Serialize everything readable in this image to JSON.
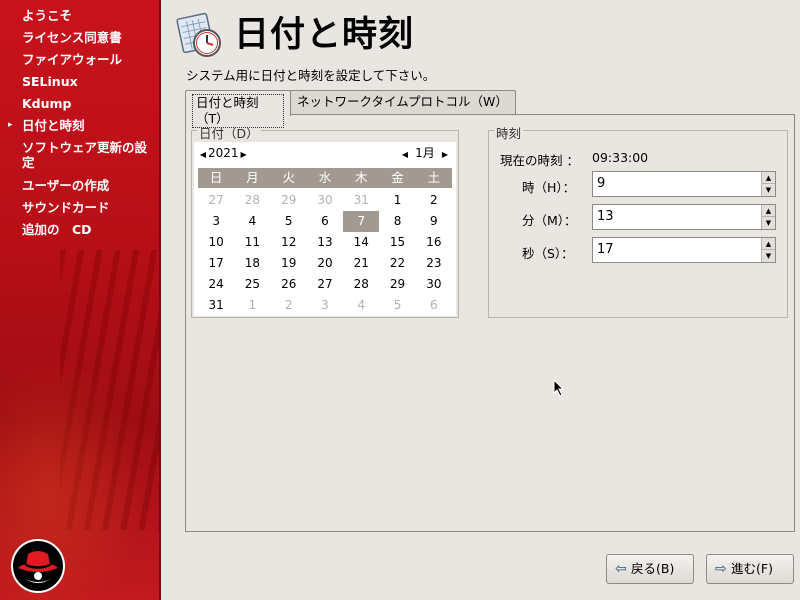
{
  "sidebar": {
    "items": [
      {
        "label": "ようこそ",
        "current": false
      },
      {
        "label": "ライセンス同意書",
        "current": false
      },
      {
        "label": "ファイアウォール",
        "current": false
      },
      {
        "label": "SELinux",
        "current": false
      },
      {
        "label": "Kdump",
        "current": false
      },
      {
        "label": "日付と時刻",
        "current": true
      },
      {
        "label": "ソフトウェア更新の設定",
        "current": false
      },
      {
        "label": "ユーザーの作成",
        "current": false
      },
      {
        "label": "サウンドカード",
        "current": false
      },
      {
        "label": "追加の　CD",
        "current": false
      }
    ],
    "current_marker": "▸"
  },
  "header": {
    "title": "日付と時刻",
    "subtitle": "システム用に日付と時刻を設定して下さい。",
    "icon": "clock-calendar-icon"
  },
  "tabs": [
    {
      "label": "日付と時刻（T）",
      "active": true
    },
    {
      "label": "ネットワークタイムプロトコル（W）",
      "active": false
    }
  ],
  "date_section": {
    "label": "日付（D）",
    "year": "2021",
    "month": "1月",
    "weekdays": [
      "日",
      "月",
      "火",
      "水",
      "木",
      "金",
      "土"
    ],
    "weeks": [
      [
        "27",
        "28",
        "29",
        "30",
        "31",
        "1",
        "2"
      ],
      [
        "3",
        "4",
        "5",
        "6",
        "7",
        "8",
        "9"
      ],
      [
        "10",
        "11",
        "12",
        "13",
        "14",
        "15",
        "16"
      ],
      [
        "17",
        "18",
        "19",
        "20",
        "21",
        "22",
        "23"
      ],
      [
        "24",
        "25",
        "26",
        "27",
        "28",
        "29",
        "30"
      ],
      [
        "31",
        "1",
        "2",
        "3",
        "4",
        "5",
        "6"
      ]
    ],
    "selected_day": "7"
  },
  "time_section": {
    "label": "時刻",
    "current_time_label": "現在の時刻 ：",
    "current_time_value": "09:33:00",
    "hour_label": "時（H）：",
    "hour_value": "9",
    "minute_label": "分（M）：",
    "minute_value": "13",
    "second_label": "秒（S）：",
    "second_value": "17"
  },
  "buttons": {
    "back_label": "戻る(B)",
    "next_label": "進む(F)"
  },
  "colors": {
    "sidebar_red": "#c8121b",
    "calendar_header": "#a19a91",
    "background": "#e9e6e1"
  }
}
